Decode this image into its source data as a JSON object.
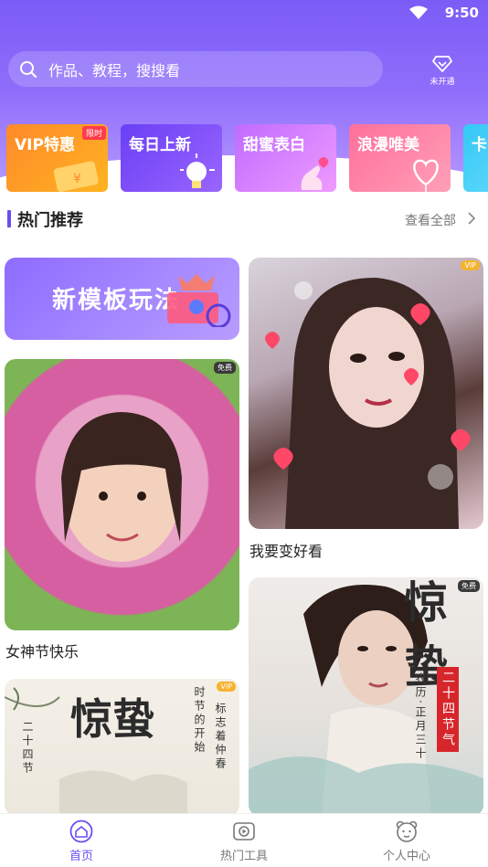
{
  "status_bar": {
    "time": "9:50"
  },
  "search": {
    "placeholder": "作品、教程，搜搜看"
  },
  "vip_entry": {
    "label": "未开通"
  },
  "categories": [
    {
      "label": "VIP特惠",
      "badge": "限时"
    },
    {
      "label": "每日上新"
    },
    {
      "label": "甜蜜表白"
    },
    {
      "label": "浪漫唯美"
    },
    {
      "label": "卡"
    }
  ],
  "section": {
    "title": "热门推荐",
    "view_all": "查看全部"
  },
  "banner": {
    "text": "新模板玩法"
  },
  "cards": [
    {
      "title": "女神节快乐",
      "tag": "免费"
    },
    {
      "title": "我要变好看",
      "tag": "VIP"
    },
    {
      "title": "",
      "tag": "VIP",
      "calligraphy": "惊蛰",
      "side_text": [
        "时节的开始",
        "标志着仲春"
      ],
      "vertical_small": "二十四节"
    },
    {
      "title": "",
      "tag": "免费",
      "calligraphy": "惊蛰",
      "text_lines": [
        "农历·正月三十"
      ],
      "red_tag": "二十四节气"
    }
  ],
  "bottom_nav": [
    {
      "label": "首页",
      "active": true
    },
    {
      "label": "热门工具"
    },
    {
      "label": "个人中心"
    }
  ],
  "colors": {
    "accent": "#6b4cf5",
    "vip_gold": "#f5b32d"
  }
}
